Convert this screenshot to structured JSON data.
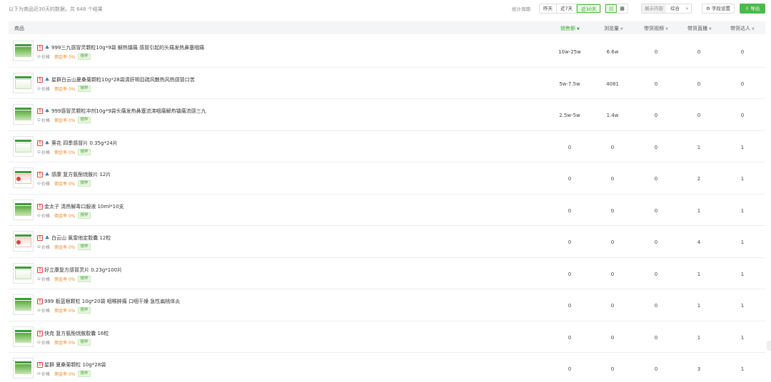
{
  "header": {
    "summary": "以下为商品近30天的数据，共 648 个结果",
    "stat_period_label": "统计周期",
    "periods": [
      "昨天",
      "近7天",
      "近30天"
    ],
    "active_period": 2,
    "view_icons": [
      "list-view-icon",
      "grid-view-icon"
    ],
    "sort_label": "展示内容",
    "sort_value": "综合",
    "field_settings": "⚙ 字段设置",
    "export": "⇩ 导出"
  },
  "table": {
    "columns": [
      "商品",
      "销售额",
      "浏览量",
      "带货视频",
      "带货直播",
      "带货达人"
    ],
    "sorted_column": 1,
    "meta_labels": {
      "price": "价格",
      "commission": "佣金率 0%",
      "sample": "报样"
    },
    "rows": [
      {
        "title": "999三九感冒灵颗粒10g*9袋 解热镇痛 感冒引起的头痛发热鼻塞咽痛",
        "blue": true,
        "sample": true,
        "thumb": "g",
        "sales": "10w-25w",
        "views": "6.6w",
        "videos": "0",
        "lives": "0",
        "kols": "0"
      },
      {
        "title": "星群白云山夏桑菊颗粒10g*28袋清肝明目疏风散热风热感冒口苦",
        "blue": true,
        "sample": true,
        "thumb": "w",
        "sales": "5w-7.5w",
        "views": "4081",
        "videos": "0",
        "lives": "0",
        "kols": "0"
      },
      {
        "title": "999感冒灵颗粒冲剂10g*9袋头痛发热鼻塞流涕咽痛解热镇痛流感三九",
        "blue": true,
        "sample": true,
        "thumb": "g",
        "sales": "2.5w-5w",
        "views": "1.4w",
        "videos": "0",
        "lives": "0",
        "kols": "0"
      },
      {
        "title": "葵花 四季感冒片 0.35g*24片",
        "blue": true,
        "sample": true,
        "thumb": "w",
        "sales": "0",
        "views": "0",
        "videos": "0",
        "lives": "1",
        "kols": "1"
      },
      {
        "title": "感康 复方氨酚烷胺片 12片",
        "blue": true,
        "sample": true,
        "thumb": "r",
        "sales": "0",
        "views": "0",
        "videos": "0",
        "lives": "2",
        "kols": "1"
      },
      {
        "title": "金太子 清热解毒口服液 10ml*10支",
        "blue": false,
        "sample": true,
        "thumb": "g",
        "sales": "0",
        "views": "0",
        "videos": "0",
        "lives": "1",
        "kols": "1"
      },
      {
        "title": "白云山 氯雷他定胶囊 12粒",
        "blue": true,
        "sample": true,
        "thumb": "r",
        "sales": "0",
        "views": "0",
        "videos": "0",
        "lives": "4",
        "kols": "1"
      },
      {
        "title": "好立康复方感冒灵片 0.23g*100片",
        "blue": false,
        "sample": true,
        "thumb": "w",
        "sales": "0",
        "views": "0",
        "videos": "0",
        "lives": "1",
        "kols": "1"
      },
      {
        "title": "999 板蓝根颗粒 10g*20袋 咽喉肿痛 口咽干燥 急性扁桃体炎",
        "blue": false,
        "sample": true,
        "thumb": "g",
        "sales": "0",
        "views": "0",
        "videos": "0",
        "lives": "1",
        "kols": "1"
      },
      {
        "title": "快克 复方氨酚烷胺胶囊 16粒",
        "blue": false,
        "sample": true,
        "thumb": "g",
        "sales": "0",
        "views": "0",
        "videos": "0",
        "lives": "1",
        "kols": "1"
      },
      {
        "title": "星群 夏桑菊颗粒 10g*28袋",
        "blue": false,
        "sample": true,
        "thumb": "g",
        "sales": "0",
        "views": "0",
        "videos": "0",
        "lives": "3",
        "kols": "1"
      }
    ]
  }
}
